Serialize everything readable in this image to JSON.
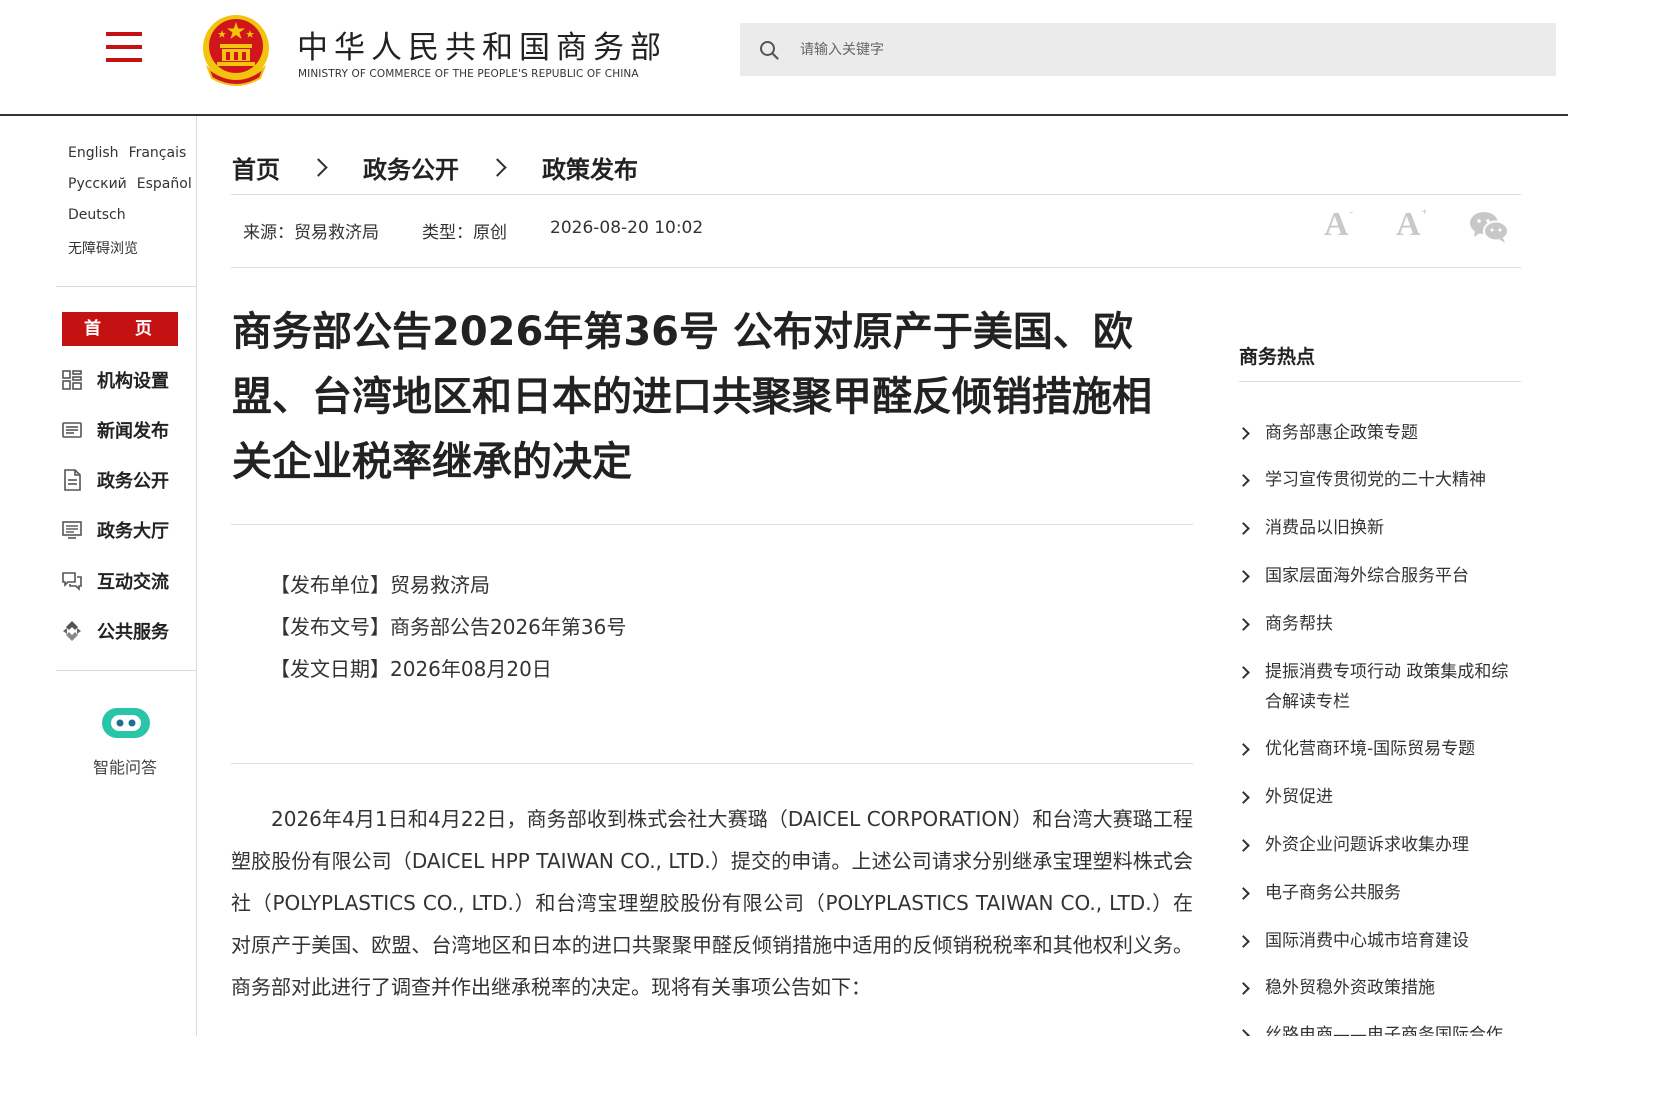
{
  "header": {
    "site_name_cn": "中华人民共和国商务部",
    "site_name_en": "MINISTRY OF COMMERCE OF THE PEOPLE'S REPUBLIC OF CHINA",
    "search_placeholder": "请输入关键字",
    "brand_color": "#c41213",
    "icons": [
      "menu-icon",
      "national-emblem",
      "search-icon"
    ]
  },
  "sidebar": {
    "languages": {
      "english": "English",
      "francais": "Français",
      "russian": "Русский",
      "espanol": "Español",
      "deutsch": "Deutsch",
      "accessible": "无障碍浏览"
    },
    "home": "首 页",
    "nav": [
      {
        "label": "机构设置",
        "icon": "grid-icon"
      },
      {
        "label": "新闻发布",
        "icon": "news-icon"
      },
      {
        "label": "政务公开",
        "icon": "document-icon"
      },
      {
        "label": "政务大厅",
        "icon": "monitor-icon"
      },
      {
        "label": "互动交流",
        "icon": "chat-icon"
      },
      {
        "label": "公共服务",
        "icon": "service-icon"
      }
    ],
    "ai_label": "智能问答"
  },
  "breadcrumb": [
    "首页",
    "政务公开",
    "政策发布"
  ],
  "meta": {
    "source": "来源：贸易救济局",
    "type": "类型：原创",
    "datetime": "2026-08-20 10:02"
  },
  "tools": {
    "font_decrease": "A",
    "font_decrease_mark": "-",
    "font_increase": "A",
    "font_increase_mark": "+"
  },
  "article": {
    "title": "商务部公告2026年第36号 公布对原产于美国、欧盟、台湾地区和日本的进口共聚聚甲醛反倾销措施相关企业税率继承的决定",
    "issuer": "【发布单位】贸易救济局",
    "doc_no": "【发布文号】商务部公告2026年第36号",
    "date": "【发文日期】2026年08月20日",
    "body": "2026年4月1日和4月22日，商务部收到株式会社大赛璐（DAICEL CORPORATION）和台湾大赛璐工程塑胶股份有限公司（DAICEL HPP TAIWAN CO., LTD.）提交的申请。上述公司请求分别继承宝理塑料株式会社（POLYPLASTICS CO., LTD.）和台湾宝理塑胶股份有限公司（POLYPLASTICS TAIWAN CO., LTD.）在对原产于美国、欧盟、台湾地区和日本的进口共聚聚甲醛反倾销措施中适用的反倾销税税率和其他权利义务。商务部对此进行了调查并作出继承税率的决定。现将有关事项公告如下："
  },
  "hot": {
    "title": "商务热点",
    "items": [
      "商务部惠企政策专题",
      "学习宣传贯彻党的二十大精神",
      "消费品以旧换新",
      "国家层面海外综合服务平台",
      "商务帮扶",
      "提振消费专项行动 政策集成和综合解读专栏",
      "优化营商环境-国际贸易专题",
      "外贸促进",
      "外资企业问题诉求收集办理",
      "电子商务公共服务",
      "国际消费中心城市培育建设",
      "稳外贸稳外资政策措施",
      "丝路电商——电子商务国际合作"
    ]
  }
}
